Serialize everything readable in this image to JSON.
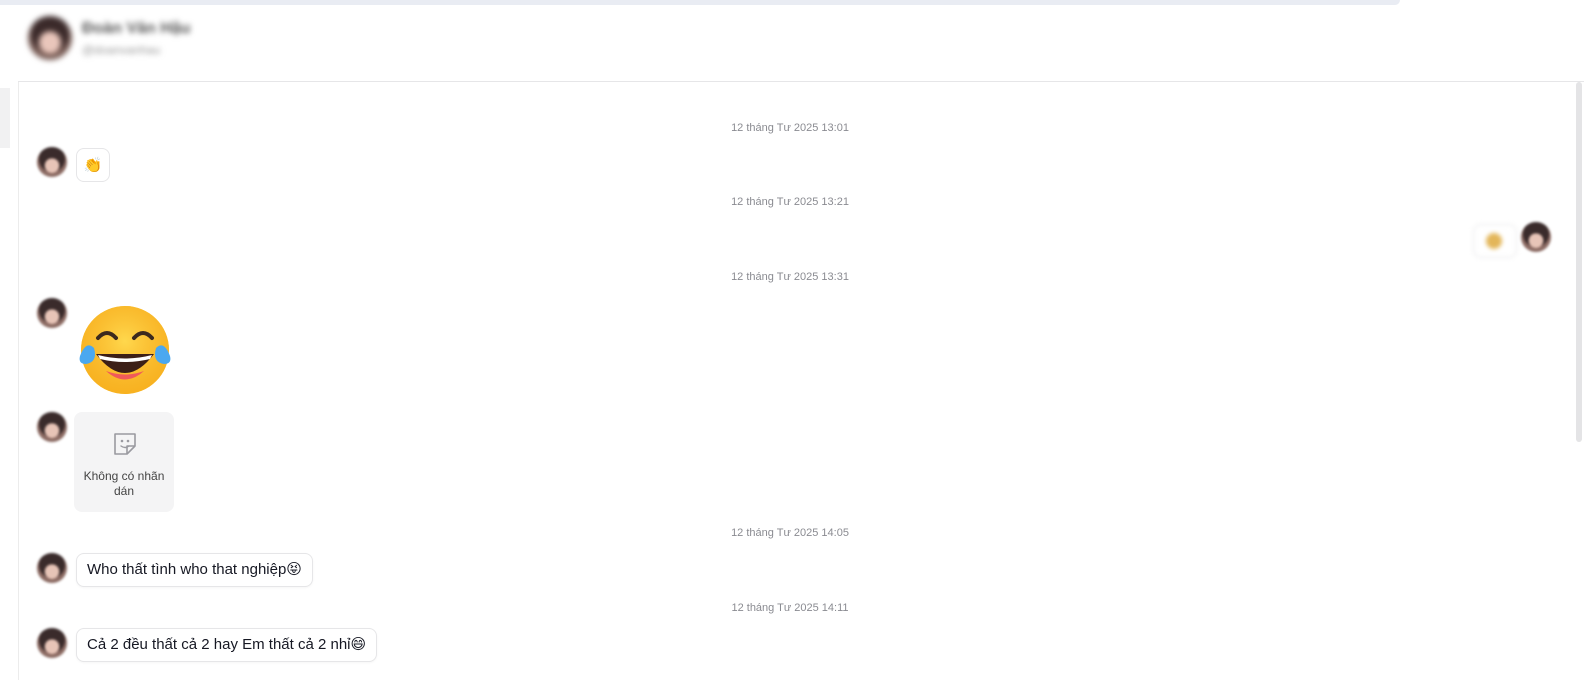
{
  "header": {
    "name": "Đoàn Văn Hậu",
    "handle": "@doanvanhau"
  },
  "timestamps": [
    "12 tháng Tư 2025 13:01",
    "12 tháng Tư 2025 13:21",
    "12 tháng Tư 2025 13:31",
    "12 tháng Tư 2025 14:05",
    "12 tháng Tư 2025 14:11"
  ],
  "messages": {
    "wave_emoji": "👏",
    "sticker_unavailable": "Không có nhãn dán",
    "text1": "Who thất tình who that nghiệp😝",
    "text2": "Cả 2 đều thất cả 2 hay Em thất cả 2 nhỉ😄"
  },
  "icons": {
    "big_emoji": "face-with-tears-of-joy-icon",
    "sticker": "sticker-placeholder-icon"
  },
  "colors": {
    "timestamp": "#8a8b91",
    "bubble_border": "#e6e6e8",
    "placeholder_bg": "#f4f4f5"
  }
}
